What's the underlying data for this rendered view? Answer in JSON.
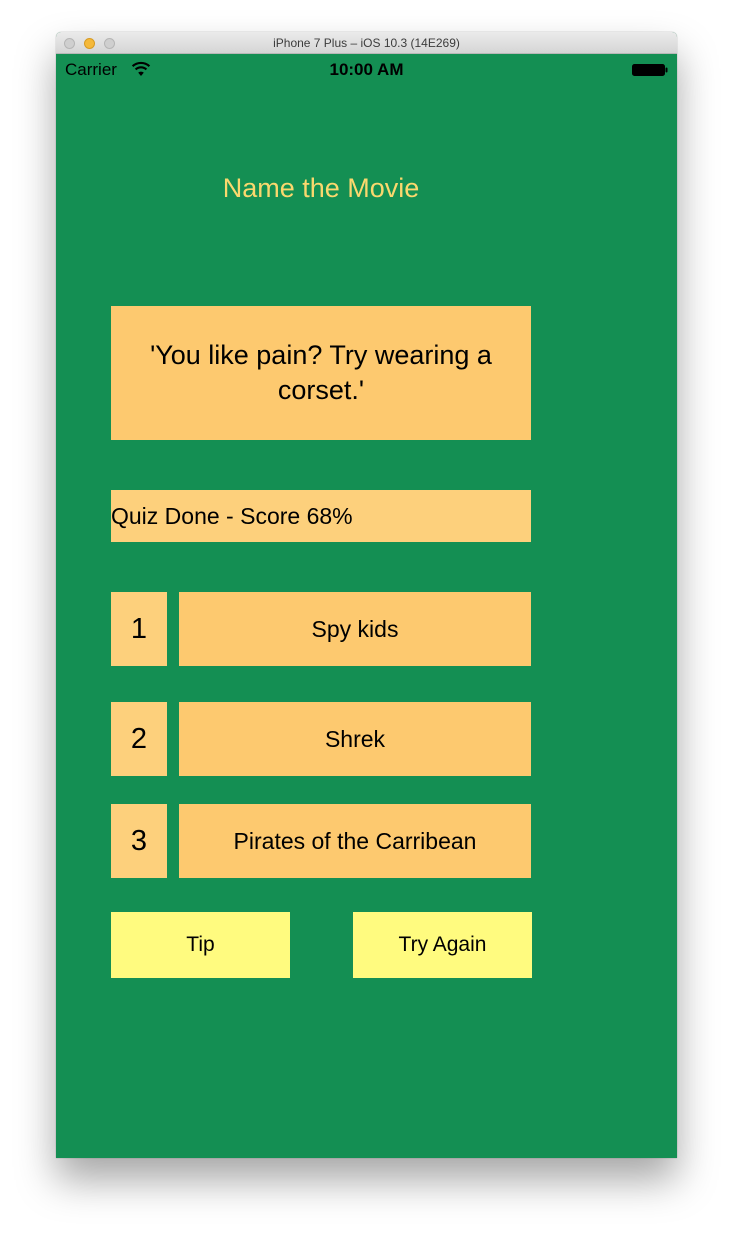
{
  "window": {
    "title": "iPhone 7 Plus – iOS 10.3 (14E269)"
  },
  "status_bar": {
    "carrier": "Carrier",
    "time": "10:00 AM",
    "wifi_icon": "wifi-icon",
    "battery_icon": "battery-icon"
  },
  "app": {
    "title": "Name the Movie",
    "quote": "'You like pain? Try wearing a corset.'",
    "status": "Quiz Done - Score 68%",
    "answers": [
      {
        "number": "1",
        "label": "Spy kids"
      },
      {
        "number": "2",
        "label": "Shrek"
      },
      {
        "number": "3",
        "label": "Pirates of the Carribean"
      }
    ],
    "tip_label": "Tip",
    "try_again_label": "Try Again"
  },
  "colors": {
    "background": "#148f53",
    "title_text": "#fad86e",
    "answer_fill": "#fdc96f",
    "label_fill": "#fdd07c",
    "action_fill": "#fffb7f"
  }
}
